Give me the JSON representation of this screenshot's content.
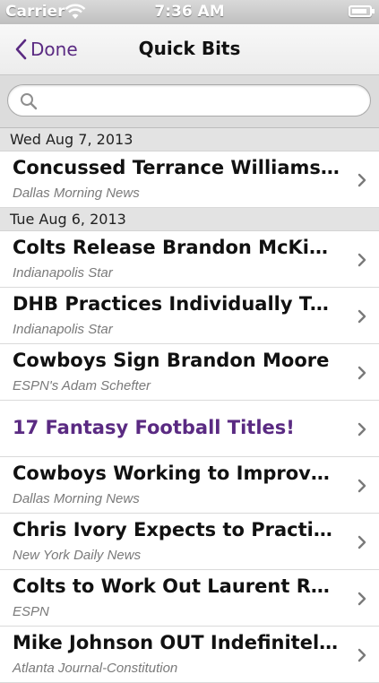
{
  "status": {
    "carrier": "Carrier",
    "time": "7:36 AM"
  },
  "nav": {
    "back": "Done",
    "title": "Quick Bits"
  },
  "search": {
    "placeholder": "",
    "value": ""
  },
  "sections": [
    {
      "date": "Wed Aug 7, 2013",
      "items": [
        {
          "title": "Concussed Terrance Williams Expected to Miss Time",
          "source": "Dallas Morning News"
        }
      ]
    },
    {
      "date": "Tue Aug 6, 2013",
      "items": [
        {
          "title": "Colts Release Brandon McKinney",
          "source": "Indianapolis Star"
        },
        {
          "title": "DHB Practices Individually Tuesday",
          "source": "Indianapolis Star"
        },
        {
          "title": "Cowboys Sign Brandon Moore",
          "source": "ESPN's Adam Schefter"
        },
        {
          "title": "17 Fantasy Football Titles!",
          "source": ""
        },
        {
          "title": "Cowboys Working to Improve Run Defense",
          "source": "Dallas Morning News"
        },
        {
          "title": "Chris Ivory Expects to Practice Soon",
          "source": "New York Daily News"
        },
        {
          "title": "Colts to Work Out Laurent Robinson",
          "source": "ESPN"
        },
        {
          "title": "Mike Johnson OUT Indefinitely with Injury",
          "source": "Atlanta Journal-Constitution"
        }
      ]
    }
  ]
}
